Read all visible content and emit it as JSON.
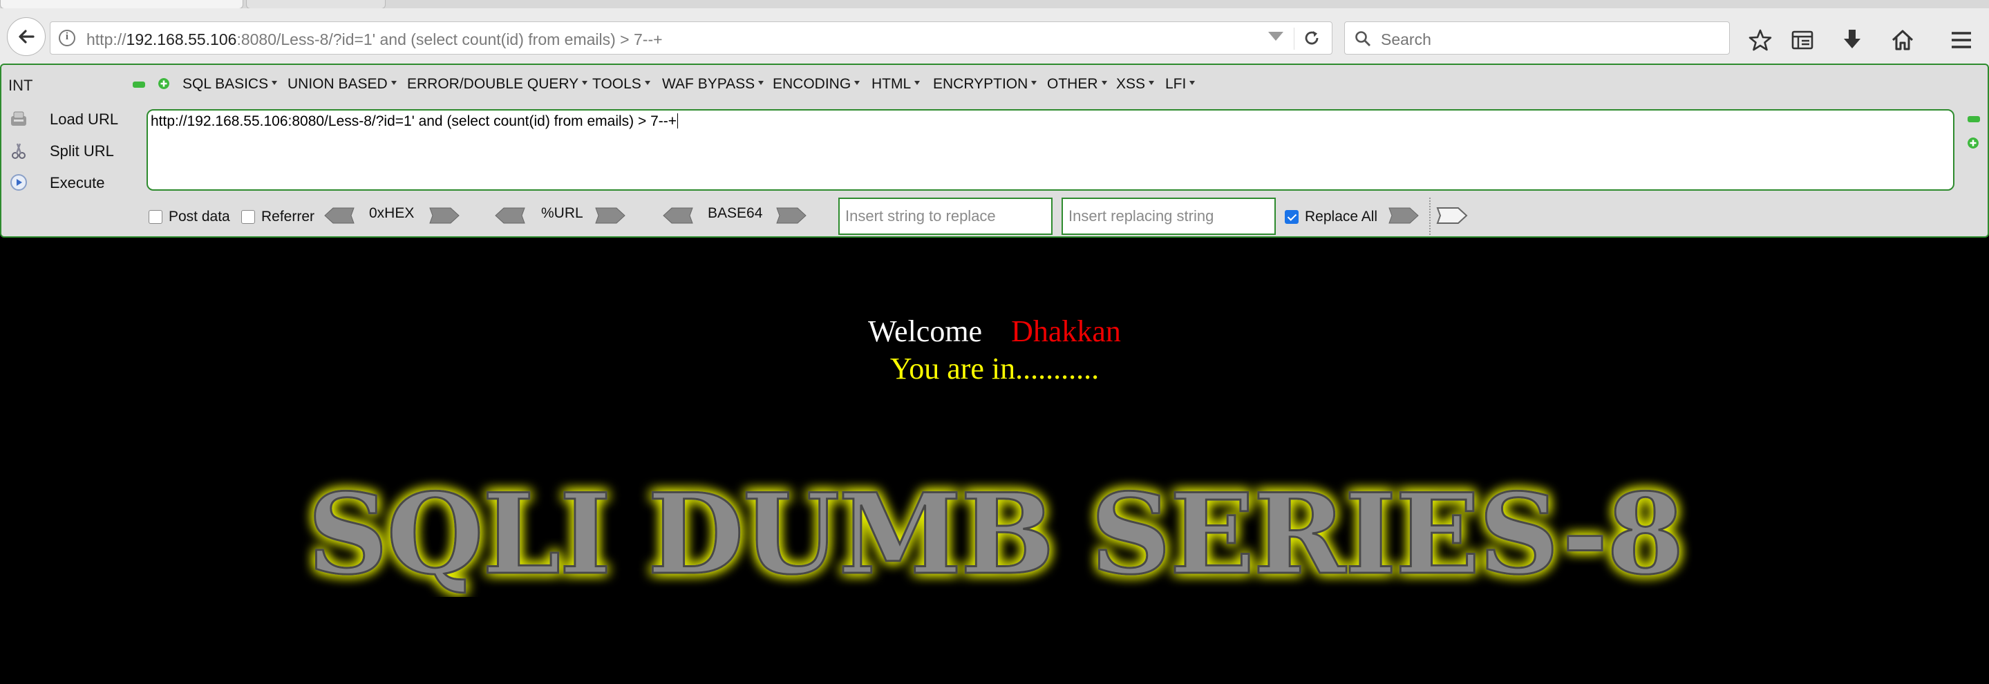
{
  "browser": {
    "url": {
      "scheme": "http://",
      "host": "192.168.55.106",
      "rest": ":8080/Less-8/?id=1' and (select count(id) from emails) > 7--+"
    },
    "search_placeholder": "Search"
  },
  "hackbar": {
    "mode_label": "INT",
    "menu": [
      {
        "label": "SQL BASICS"
      },
      {
        "label": "UNION BASED"
      },
      {
        "label": "ERROR/DOUBLE QUERY"
      },
      {
        "label": "TOOLS"
      },
      {
        "label": "WAF BYPASS"
      },
      {
        "label": "ENCODING"
      },
      {
        "label": "HTML"
      },
      {
        "label": "ENCRYPTION"
      },
      {
        "label": "OTHER"
      },
      {
        "label": "XSS"
      },
      {
        "label": "LFI"
      }
    ],
    "actions": {
      "load": "Load URL",
      "split": "Split URL",
      "execute": "Execute"
    },
    "url_value": "http://192.168.55.106:8080/Less-8/?id=1' and (select count(id) from emails) > 7--+",
    "post_data_label": "Post data",
    "post_data_checked": false,
    "referrer_label": "Referrer",
    "referrer_checked": false,
    "hex_label": "0xHEX",
    "url_enc_label": "%URL",
    "base64_label": "BASE64",
    "replace_placeholder": "Insert string to replace",
    "replacing_placeholder": "Insert replacing string",
    "replace_all_label": "Replace All",
    "replace_all_checked": true
  },
  "page": {
    "welcome": "Welcome",
    "user_name": "Dhakkan",
    "status": "You are in...........",
    "banner": "SQLI DUMB SERIES-8",
    "colors": {
      "background": "#000000",
      "welcome": "#ffffff",
      "name": "#ee0000",
      "status": "#ffff00",
      "banner_glow": "#e8f000"
    }
  }
}
